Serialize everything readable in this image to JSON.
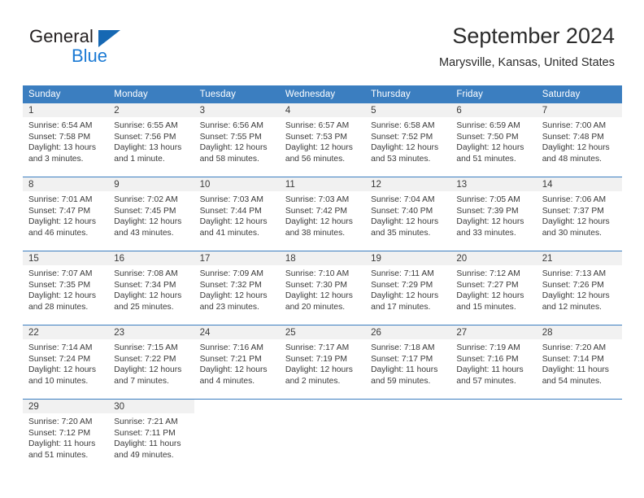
{
  "brand": {
    "name_part1": "General",
    "name_part2": "Blue",
    "flag_icon": "triangle-flag-icon"
  },
  "header": {
    "title": "September 2024",
    "location": "Marysville, Kansas, United States"
  },
  "colors": {
    "header_blue": "#3b7ec0",
    "brand_blue": "#1b7ad4",
    "daynum_band": "#f1f1f1",
    "text": "#3a3a3a"
  },
  "weekday_headers": [
    "Sunday",
    "Monday",
    "Tuesday",
    "Wednesday",
    "Thursday",
    "Friday",
    "Saturday"
  ],
  "weeks": [
    [
      {
        "day": "1",
        "sunrise": "Sunrise: 6:54 AM",
        "sunset": "Sunset: 7:58 PM",
        "daylight_line1": "Daylight: 13 hours",
        "daylight_line2": "and 3 minutes."
      },
      {
        "day": "2",
        "sunrise": "Sunrise: 6:55 AM",
        "sunset": "Sunset: 7:56 PM",
        "daylight_line1": "Daylight: 13 hours",
        "daylight_line2": "and 1 minute."
      },
      {
        "day": "3",
        "sunrise": "Sunrise: 6:56 AM",
        "sunset": "Sunset: 7:55 PM",
        "daylight_line1": "Daylight: 12 hours",
        "daylight_line2": "and 58 minutes."
      },
      {
        "day": "4",
        "sunrise": "Sunrise: 6:57 AM",
        "sunset": "Sunset: 7:53 PM",
        "daylight_line1": "Daylight: 12 hours",
        "daylight_line2": "and 56 minutes."
      },
      {
        "day": "5",
        "sunrise": "Sunrise: 6:58 AM",
        "sunset": "Sunset: 7:52 PM",
        "daylight_line1": "Daylight: 12 hours",
        "daylight_line2": "and 53 minutes."
      },
      {
        "day": "6",
        "sunrise": "Sunrise: 6:59 AM",
        "sunset": "Sunset: 7:50 PM",
        "daylight_line1": "Daylight: 12 hours",
        "daylight_line2": "and 51 minutes."
      },
      {
        "day": "7",
        "sunrise": "Sunrise: 7:00 AM",
        "sunset": "Sunset: 7:48 PM",
        "daylight_line1": "Daylight: 12 hours",
        "daylight_line2": "and 48 minutes."
      }
    ],
    [
      {
        "day": "8",
        "sunrise": "Sunrise: 7:01 AM",
        "sunset": "Sunset: 7:47 PM",
        "daylight_line1": "Daylight: 12 hours",
        "daylight_line2": "and 46 minutes."
      },
      {
        "day": "9",
        "sunrise": "Sunrise: 7:02 AM",
        "sunset": "Sunset: 7:45 PM",
        "daylight_line1": "Daylight: 12 hours",
        "daylight_line2": "and 43 minutes."
      },
      {
        "day": "10",
        "sunrise": "Sunrise: 7:03 AM",
        "sunset": "Sunset: 7:44 PM",
        "daylight_line1": "Daylight: 12 hours",
        "daylight_line2": "and 41 minutes."
      },
      {
        "day": "11",
        "sunrise": "Sunrise: 7:03 AM",
        "sunset": "Sunset: 7:42 PM",
        "daylight_line1": "Daylight: 12 hours",
        "daylight_line2": "and 38 minutes."
      },
      {
        "day": "12",
        "sunrise": "Sunrise: 7:04 AM",
        "sunset": "Sunset: 7:40 PM",
        "daylight_line1": "Daylight: 12 hours",
        "daylight_line2": "and 35 minutes."
      },
      {
        "day": "13",
        "sunrise": "Sunrise: 7:05 AM",
        "sunset": "Sunset: 7:39 PM",
        "daylight_line1": "Daylight: 12 hours",
        "daylight_line2": "and 33 minutes."
      },
      {
        "day": "14",
        "sunrise": "Sunrise: 7:06 AM",
        "sunset": "Sunset: 7:37 PM",
        "daylight_line1": "Daylight: 12 hours",
        "daylight_line2": "and 30 minutes."
      }
    ],
    [
      {
        "day": "15",
        "sunrise": "Sunrise: 7:07 AM",
        "sunset": "Sunset: 7:35 PM",
        "daylight_line1": "Daylight: 12 hours",
        "daylight_line2": "and 28 minutes."
      },
      {
        "day": "16",
        "sunrise": "Sunrise: 7:08 AM",
        "sunset": "Sunset: 7:34 PM",
        "daylight_line1": "Daylight: 12 hours",
        "daylight_line2": "and 25 minutes."
      },
      {
        "day": "17",
        "sunrise": "Sunrise: 7:09 AM",
        "sunset": "Sunset: 7:32 PM",
        "daylight_line1": "Daylight: 12 hours",
        "daylight_line2": "and 23 minutes."
      },
      {
        "day": "18",
        "sunrise": "Sunrise: 7:10 AM",
        "sunset": "Sunset: 7:30 PM",
        "daylight_line1": "Daylight: 12 hours",
        "daylight_line2": "and 20 minutes."
      },
      {
        "day": "19",
        "sunrise": "Sunrise: 7:11 AM",
        "sunset": "Sunset: 7:29 PM",
        "daylight_line1": "Daylight: 12 hours",
        "daylight_line2": "and 17 minutes."
      },
      {
        "day": "20",
        "sunrise": "Sunrise: 7:12 AM",
        "sunset": "Sunset: 7:27 PM",
        "daylight_line1": "Daylight: 12 hours",
        "daylight_line2": "and 15 minutes."
      },
      {
        "day": "21",
        "sunrise": "Sunrise: 7:13 AM",
        "sunset": "Sunset: 7:26 PM",
        "daylight_line1": "Daylight: 12 hours",
        "daylight_line2": "and 12 minutes."
      }
    ],
    [
      {
        "day": "22",
        "sunrise": "Sunrise: 7:14 AM",
        "sunset": "Sunset: 7:24 PM",
        "daylight_line1": "Daylight: 12 hours",
        "daylight_line2": "and 10 minutes."
      },
      {
        "day": "23",
        "sunrise": "Sunrise: 7:15 AM",
        "sunset": "Sunset: 7:22 PM",
        "daylight_line1": "Daylight: 12 hours",
        "daylight_line2": "and 7 minutes."
      },
      {
        "day": "24",
        "sunrise": "Sunrise: 7:16 AM",
        "sunset": "Sunset: 7:21 PM",
        "daylight_line1": "Daylight: 12 hours",
        "daylight_line2": "and 4 minutes."
      },
      {
        "day": "25",
        "sunrise": "Sunrise: 7:17 AM",
        "sunset": "Sunset: 7:19 PM",
        "daylight_line1": "Daylight: 12 hours",
        "daylight_line2": "and 2 minutes."
      },
      {
        "day": "26",
        "sunrise": "Sunrise: 7:18 AM",
        "sunset": "Sunset: 7:17 PM",
        "daylight_line1": "Daylight: 11 hours",
        "daylight_line2": "and 59 minutes."
      },
      {
        "day": "27",
        "sunrise": "Sunrise: 7:19 AM",
        "sunset": "Sunset: 7:16 PM",
        "daylight_line1": "Daylight: 11 hours",
        "daylight_line2": "and 57 minutes."
      },
      {
        "day": "28",
        "sunrise": "Sunrise: 7:20 AM",
        "sunset": "Sunset: 7:14 PM",
        "daylight_line1": "Daylight: 11 hours",
        "daylight_line2": "and 54 minutes."
      }
    ],
    [
      {
        "day": "29",
        "sunrise": "Sunrise: 7:20 AM",
        "sunset": "Sunset: 7:12 PM",
        "daylight_line1": "Daylight: 11 hours",
        "daylight_line2": "and 51 minutes."
      },
      {
        "day": "30",
        "sunrise": "Sunrise: 7:21 AM",
        "sunset": "Sunset: 7:11 PM",
        "daylight_line1": "Daylight: 11 hours",
        "daylight_line2": "and 49 minutes."
      },
      {
        "day": "",
        "sunrise": "",
        "sunset": "",
        "daylight_line1": "",
        "daylight_line2": ""
      },
      {
        "day": "",
        "sunrise": "",
        "sunset": "",
        "daylight_line1": "",
        "daylight_line2": ""
      },
      {
        "day": "",
        "sunrise": "",
        "sunset": "",
        "daylight_line1": "",
        "daylight_line2": ""
      },
      {
        "day": "",
        "sunrise": "",
        "sunset": "",
        "daylight_line1": "",
        "daylight_line2": ""
      },
      {
        "day": "",
        "sunrise": "",
        "sunset": "",
        "daylight_line1": "",
        "daylight_line2": ""
      }
    ]
  ]
}
